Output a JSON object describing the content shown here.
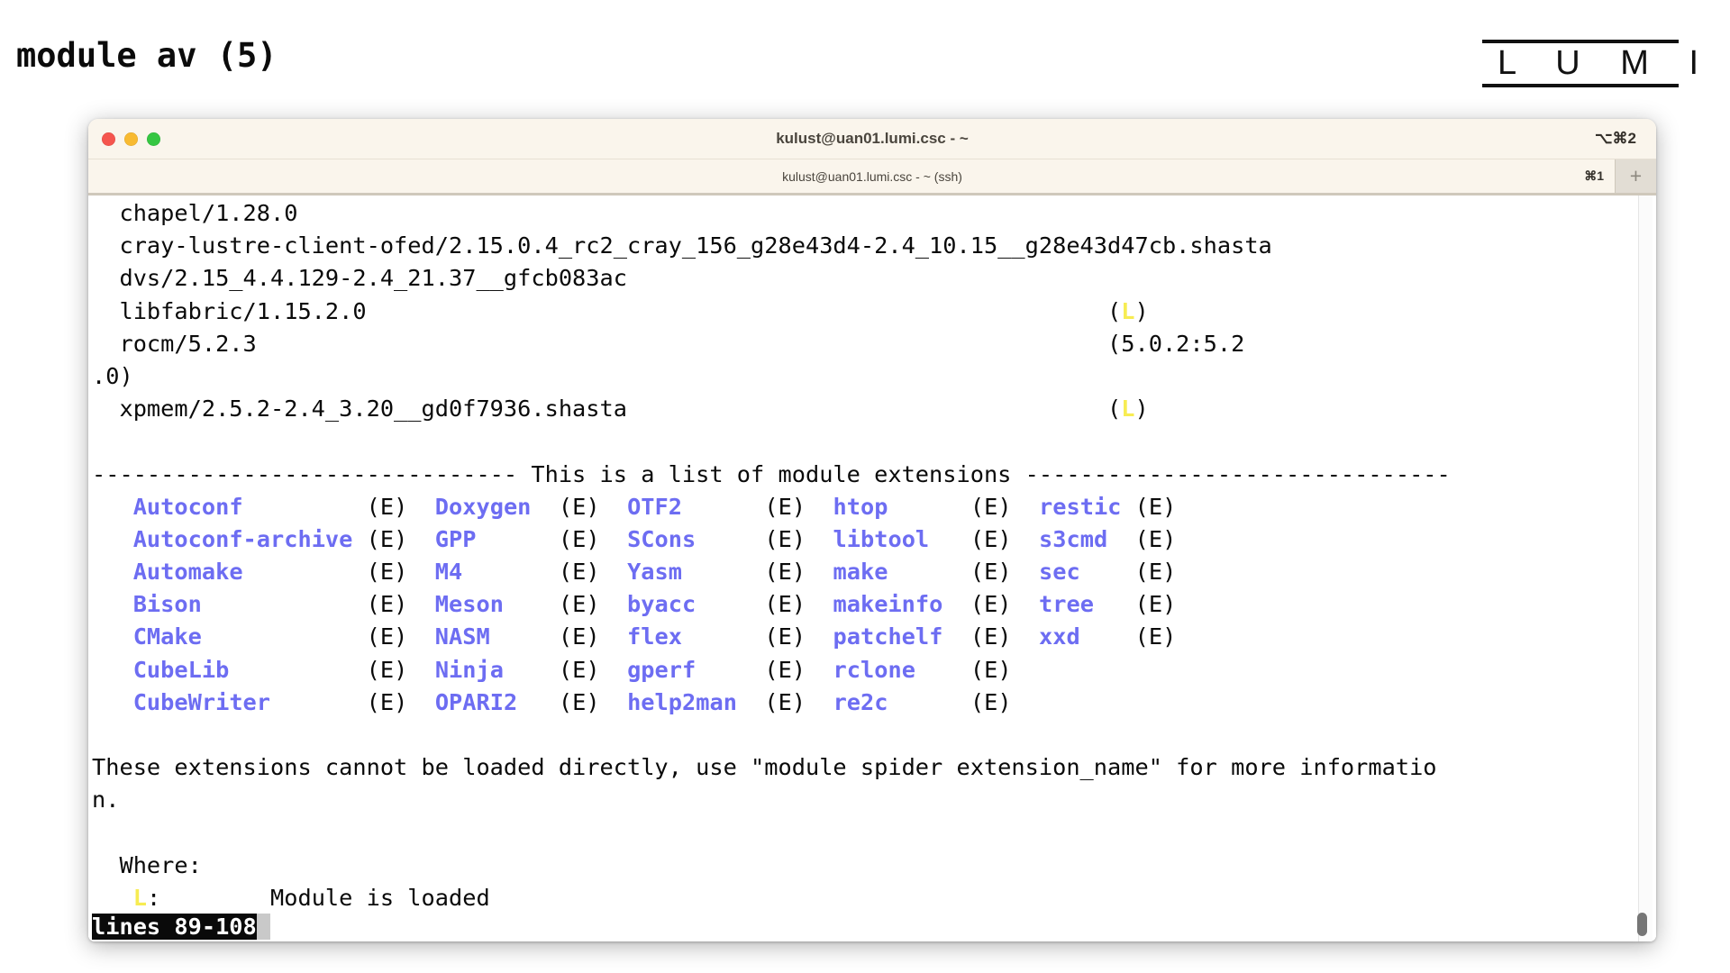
{
  "slide": {
    "title": "module av (5)",
    "logo_text": "L U M I"
  },
  "terminal": {
    "window_title": "kulust@uan01.lumi.csc - ~",
    "window_shortcut": "⌥⌘2",
    "tab_title": "kulust@uan01.lumi.csc - ~ (ssh)",
    "tab_shortcut": "⌘1",
    "new_tab_label": "+",
    "traffic_lights": [
      "close-button",
      "minimize-button",
      "zoom-button"
    ],
    "status_text": "lines 89-108",
    "status_cursor": " ",
    "colors": {
      "extension_blue": "#6d6df2",
      "loaded_yellow": "#f7ec52",
      "titlebar_bg": "#faf5ec",
      "terminal_bg": "#ffffff",
      "text": "#0a0a0a"
    },
    "lines": [
      {
        "id": "module-chapel",
        "text": "  chapel/1.28.0"
      },
      {
        "id": "module-cray-lustre",
        "text": "  cray-lustre-client-ofed/2.15.0.4_rc2_cray_156_g28e43d4-2.4_10.15__g28e43d47cb.shasta"
      },
      {
        "id": "module-dvs",
        "text": "  dvs/2.15_4.4.129-2.4_21.37__gfcb083ac"
      },
      {
        "id": "module-libfabric",
        "text": "  libfabric/1.15.2.0",
        "tail": "(L)",
        "tail_kind": "loaded",
        "tail_col": 74
      },
      {
        "id": "module-rocm",
        "text": "  rocm/5.2.3",
        "tail": "(5.0.2:5.2",
        "tail_kind": "plain",
        "tail_col": 74
      },
      {
        "id": "module-rocm-wrap",
        "text": ".0)"
      },
      {
        "id": "module-xpmem",
        "text": "  xpmem/2.5.2-2.4_3.20__gd0f7936.shasta",
        "tail": "(L)",
        "tail_kind": "loaded",
        "tail_col": 74
      },
      {
        "id": "blank-1",
        "text": ""
      },
      {
        "id": "extensions-header",
        "text": "------------------------------- This is a list of module extensions -------------------------------"
      },
      {
        "id": "blank-2",
        "text": ""
      },
      {
        "id": "note-1",
        "text": "These extensions cannot be loaded directly, use \"module spider extension_name\" for more informatio"
      },
      {
        "id": "note-2",
        "text": "n."
      },
      {
        "id": "blank-3",
        "text": ""
      },
      {
        "id": "where-header",
        "text": "  Where:"
      },
      {
        "id": "where-loaded",
        "text": "   L:        Module is loaded",
        "marker": "L",
        "marker_desc": "Module is loaded"
      }
    ],
    "extensions_marker": "(E)",
    "extensions_columns": [
      [
        "Autoconf",
        "Autoconf-archive",
        "Automake",
        "Bison",
        "CMake",
        "CubeLib",
        "CubeWriter"
      ],
      [
        "Doxygen",
        "GPP",
        "M4",
        "Meson",
        "NASM",
        "Ninja",
        "OPARI2"
      ],
      [
        "OTF2",
        "SCons",
        "Yasm",
        "byacc",
        "flex",
        "gperf",
        "help2man"
      ],
      [
        "htop",
        "libtool",
        "make",
        "makeinfo",
        "patchelf",
        "rclone",
        "re2c"
      ],
      [
        "restic",
        "s3cmd",
        "sec",
        "tree",
        "xxd"
      ]
    ]
  }
}
